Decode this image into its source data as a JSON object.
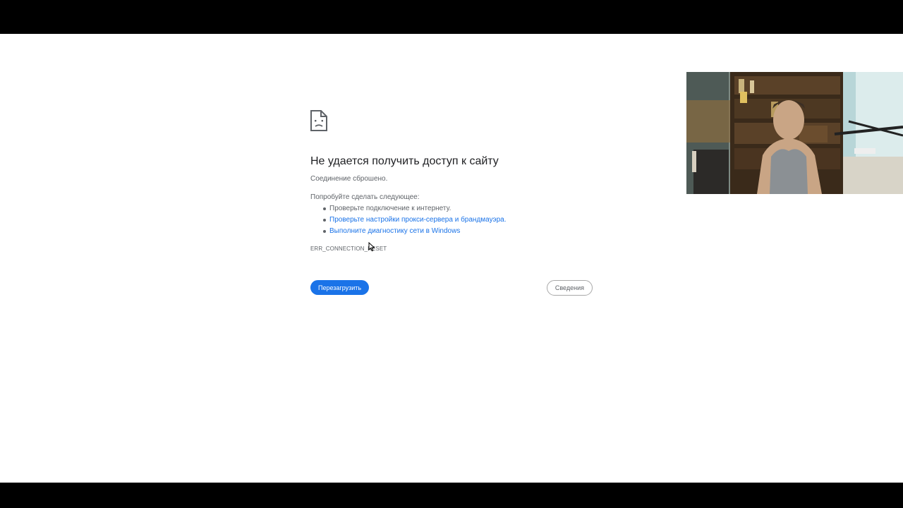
{
  "error_page": {
    "title": "Не удается получить доступ к сайту",
    "subtitle": "Соединение сброшено.",
    "suggestions_heading": "Попробуйте сделать следующее:",
    "suggestions": [
      {
        "text": "Проверьте подключение к интернету.",
        "link": false
      },
      {
        "text": "Проверьте настройки прокси-сервера и брандмауэра.",
        "link": true
      },
      {
        "text": "Выполните диагностику сети в Windows",
        "link": true
      }
    ],
    "error_code": "ERR_CONNECTION_RESET",
    "reload_button": "Перезагрузить",
    "details_button": "Сведения"
  },
  "icons": {
    "error_icon": "sad-page-icon",
    "cursor": "mouse-cursor-icon"
  },
  "colors": {
    "accent": "#1a73e8",
    "text_primary": "#202124",
    "text_secondary": "#5f6368",
    "background": "#ffffff",
    "letterbox": "#000000"
  }
}
